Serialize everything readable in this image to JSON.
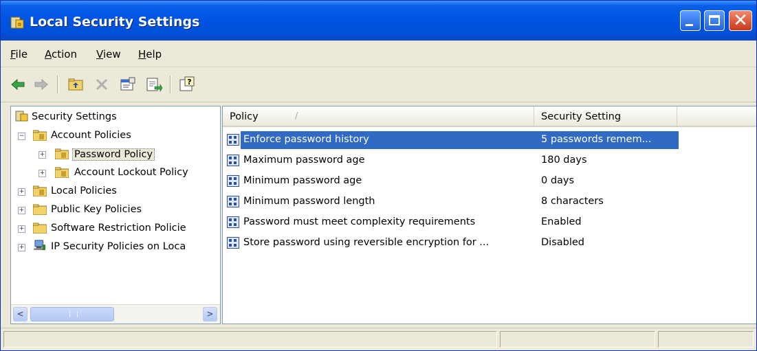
{
  "window": {
    "title": "Local Security Settings",
    "close_glyph": "✕"
  },
  "menu": {
    "items": [
      "File",
      "Action",
      "View",
      "Help"
    ]
  },
  "toolbar": {
    "icons": [
      "back-arrow-icon",
      "forward-arrow-icon",
      "up-folder-icon",
      "delete-icon",
      "properties-icon",
      "export-list-icon",
      "help-icon"
    ]
  },
  "tree": {
    "root": "Security Settings",
    "nodes": [
      {
        "label": "Account Policies",
        "expander": "−"
      },
      {
        "label": "Password Policy",
        "expander": "+"
      },
      {
        "label": "Account Lockout Policy",
        "expander": "+"
      },
      {
        "label": "Local Policies",
        "expander": "+"
      },
      {
        "label": "Public Key Policies",
        "expander": "+"
      },
      {
        "label": "Software Restriction Policie",
        "expander": "+"
      },
      {
        "label": "IP Security Policies on Loca",
        "expander": "+"
      }
    ],
    "scroll_left": "<",
    "scroll_right": ">"
  },
  "list": {
    "columns": [
      "Policy",
      "Security Setting"
    ],
    "sort_indicator": "/",
    "rows": [
      {
        "policy": "Enforce password history",
        "setting": "5 passwords remem..."
      },
      {
        "policy": "Maximum password age",
        "setting": "180 days"
      },
      {
        "policy": "Minimum password age",
        "setting": "0 days"
      },
      {
        "policy": "Minimum password length",
        "setting": "8 characters"
      },
      {
        "policy": "Password must meet complexity requirements",
        "setting": "Enabled"
      },
      {
        "policy": "Store password using reversible encryption for ...",
        "setting": "Disabled"
      }
    ]
  },
  "colors": {
    "titlebar": "#0054e3",
    "selection": "#316ac5",
    "chrome": "#ece9d8"
  }
}
